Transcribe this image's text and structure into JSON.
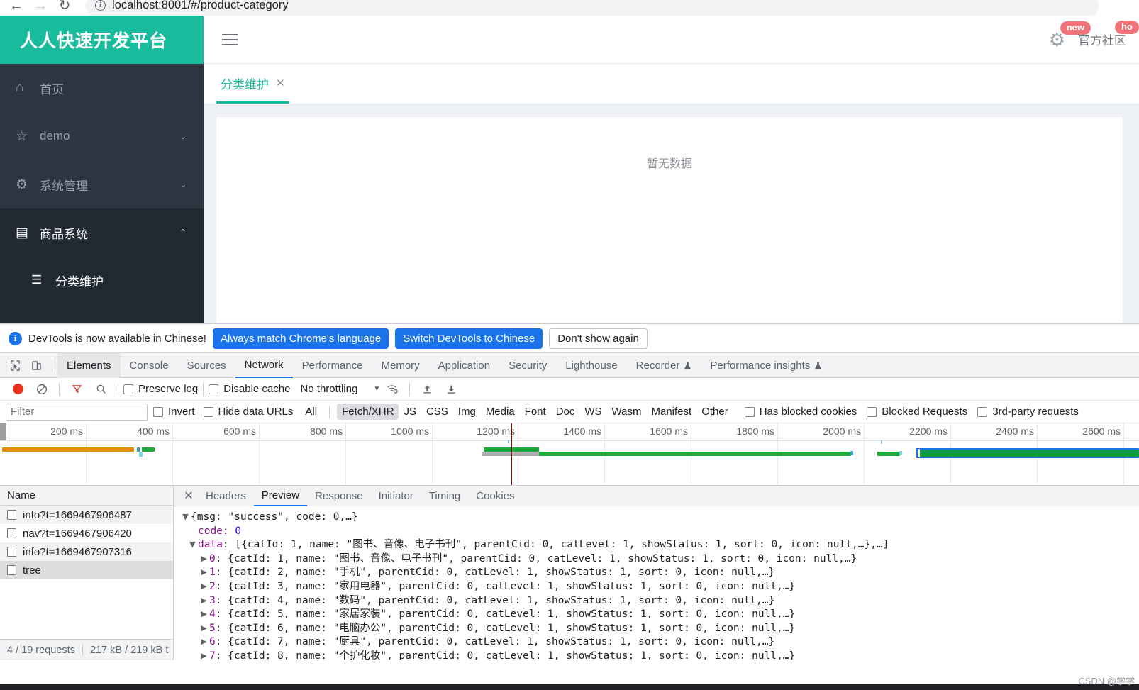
{
  "browser": {
    "back_icon": "←",
    "forward_icon": "→",
    "reload_icon": "↻",
    "info_glyph": "i",
    "url": "localhost:8001/#/product-category"
  },
  "app": {
    "logo": "人人快速开发平台",
    "sidebar": [
      {
        "label": "首页",
        "icon": "home-icon",
        "glyph": "⌂",
        "caret": "",
        "state": "normal"
      },
      {
        "label": "demo",
        "icon": "star-icon",
        "glyph": "☆",
        "caret": "⌄",
        "state": "normal"
      },
      {
        "label": "系统管理",
        "icon": "gear-icon",
        "glyph": "⚙",
        "caret": "⌄",
        "state": "normal"
      },
      {
        "label": "商品系统",
        "icon": "window-icon",
        "glyph": "▤",
        "caret": "⌃",
        "state": "open"
      }
    ],
    "sidebar_sub": {
      "label": "分类维护",
      "icon": "list-icon",
      "glyph": "☰"
    },
    "topbar": {
      "menu_icon": "hamburger-icon",
      "gear_icon": "gear-icon",
      "gear_badge": "new",
      "community_label": "官方社区",
      "community_badge": "ho"
    },
    "tab": {
      "label": "分类维护",
      "close": "✕"
    },
    "empty_text": "暂无数据",
    "accent_color": "#18bc9c",
    "sidebar_color": "#2c3540"
  },
  "devtools": {
    "lang_banner": {
      "message": "DevTools is now available in Chinese!",
      "btn_always": "Always match Chrome's language",
      "btn_switch": "Switch DevTools to Chinese",
      "btn_dismiss": "Don't show again",
      "info_glyph": "i"
    },
    "tabs": [
      {
        "label": "Elements",
        "active": false,
        "flask": false
      },
      {
        "label": "Console",
        "active": false,
        "flask": false
      },
      {
        "label": "Sources",
        "active": false,
        "flask": false
      },
      {
        "label": "Network",
        "active": true,
        "flask": false
      },
      {
        "label": "Performance",
        "active": false,
        "flask": false
      },
      {
        "label": "Memory",
        "active": false,
        "flask": false
      },
      {
        "label": "Application",
        "active": false,
        "flask": false
      },
      {
        "label": "Security",
        "active": false,
        "flask": false
      },
      {
        "label": "Lighthouse",
        "active": false,
        "flask": false
      },
      {
        "label": "Recorder",
        "active": false,
        "flask": true
      },
      {
        "label": "Performance insights",
        "active": false,
        "flask": true
      }
    ],
    "toolbar": {
      "record_title": "record-button",
      "clear_title": "clear-button",
      "filter_title": "filter-button",
      "search_title": "search-button",
      "preserve_log": "Preserve log",
      "disable_cache": "Disable cache",
      "throttling": "No throttling",
      "caret": "▼",
      "import_icon": "⬆",
      "export_icon": "⬇"
    },
    "filter_row": {
      "placeholder": "Filter",
      "value": "",
      "invert": "Invert",
      "hide_data_urls": "Hide data URLs",
      "types": [
        "All",
        "Fetch/XHR",
        "JS",
        "CSS",
        "Img",
        "Media",
        "Font",
        "Doc",
        "WS",
        "Wasm",
        "Manifest",
        "Other"
      ],
      "active_type": "Fetch/XHR",
      "has_blocked_cookies": "Has blocked cookies",
      "blocked_requests": "Blocked Requests",
      "third_party": "3rd-party requests"
    },
    "waterfall": {
      "ticks": [
        "200 ms",
        "400 ms",
        "600 ms",
        "800 ms",
        "1000 ms",
        "1200 ms",
        "1400 ms",
        "1600 ms",
        "1800 ms",
        "2000 ms",
        "2200 ms",
        "2400 ms",
        "2600 ms"
      ]
    },
    "requests": {
      "column": "Name",
      "rows": [
        {
          "name": "info?t=1669467906487"
        },
        {
          "name": "nav?t=1669467906420"
        },
        {
          "name": "info?t=1669467907316"
        },
        {
          "name": "tree"
        }
      ]
    },
    "detail_tabs": [
      {
        "label": "Headers",
        "active": false
      },
      {
        "label": "Preview",
        "active": true
      },
      {
        "label": "Response",
        "active": false
      },
      {
        "label": "Initiator",
        "active": false
      },
      {
        "label": "Timing",
        "active": false
      },
      {
        "label": "Cookies",
        "active": false
      }
    ],
    "preview": {
      "root": "{msg: \"success\", code: 0,…}",
      "code_key": "code",
      "code_value": "0",
      "data_key": "data",
      "data_summary": "[{catId: 1, name: \"图书、音像、电子书刊\", parentCid: 0, catLevel: 1, showStatus: 1, sort: 0, icon: null,…},…]",
      "items": [
        {
          "index": "0",
          "text": "{catId: 1, name: \"图书、音像、电子书刊\", parentCid: 0, catLevel: 1, showStatus: 1, sort: 0, icon: null,…}"
        },
        {
          "index": "1",
          "text": "{catId: 2, name: \"手机\", parentCid: 0, catLevel: 1, showStatus: 1, sort: 0, icon: null,…}"
        },
        {
          "index": "2",
          "text": "{catId: 3, name: \"家用电器\", parentCid: 0, catLevel: 1, showStatus: 1, sort: 0, icon: null,…}"
        },
        {
          "index": "3",
          "text": "{catId: 4, name: \"数码\", parentCid: 0, catLevel: 1, showStatus: 1, sort: 0, icon: null,…}"
        },
        {
          "index": "4",
          "text": "{catId: 5, name: \"家居家装\", parentCid: 0, catLevel: 1, showStatus: 1, sort: 0, icon: null,…}"
        },
        {
          "index": "5",
          "text": "{catId: 6, name: \"电脑办公\", parentCid: 0, catLevel: 1, showStatus: 1, sort: 0, icon: null,…}"
        },
        {
          "index": "6",
          "text": "{catId: 7, name: \"厨具\", parentCid: 0, catLevel: 1, showStatus: 1, sort: 0, icon: null,…}"
        },
        {
          "index": "7",
          "text": "{catId: 8, name: \"个护化妆\", parentCid: 0, catLevel: 1, showStatus: 1, sort: 0, icon: null,…}"
        }
      ]
    },
    "status": {
      "requests": "4 / 19 requests",
      "transfer": "217 kB / 219 kB t"
    }
  },
  "watermark": "CSDN @学学"
}
